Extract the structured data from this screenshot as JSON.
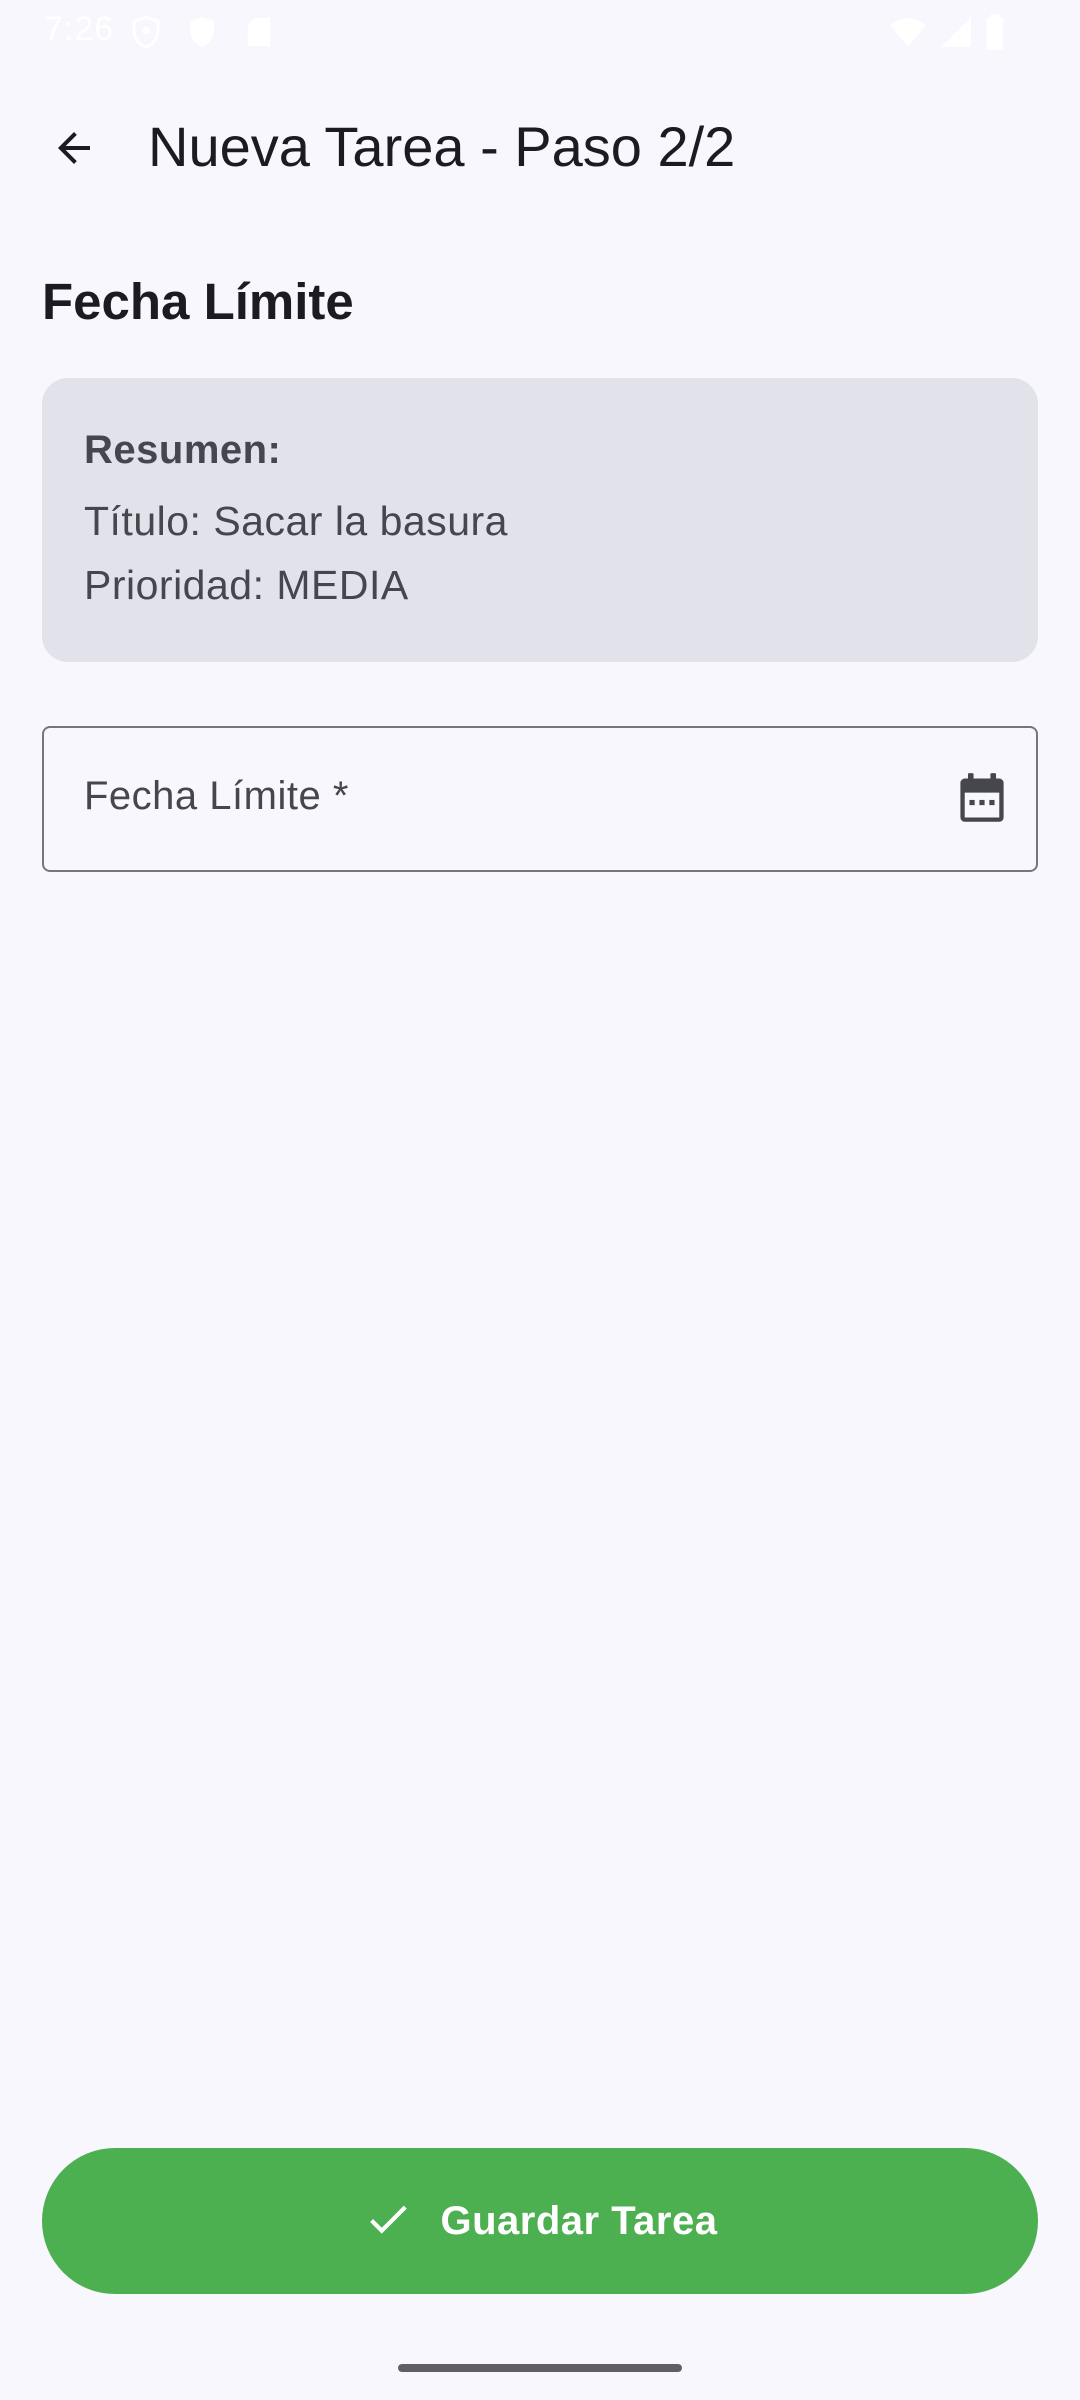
{
  "status_bar": {
    "time": "7:26",
    "icons": [
      "shield-icon",
      "location-shield-icon",
      "sd-card-icon",
      "wifi-icon",
      "cellular-signal-icon",
      "battery-icon"
    ]
  },
  "app_bar": {
    "back_icon": "arrow-back-icon",
    "title": "Nueva Tarea - Paso 2/2"
  },
  "section": {
    "title": "Fecha Límite"
  },
  "summary": {
    "heading": "Resumen:",
    "title_line": "Título: Sacar la basura",
    "priority_line": "Prioridad: MEDIA"
  },
  "date_field": {
    "label": "Fecha Límite *",
    "value": "",
    "trailing_icon": "calendar-icon"
  },
  "save_button": {
    "icon": "check-icon",
    "label": "Guardar Tarea"
  },
  "colors": {
    "background": "#f7f7fd",
    "summary_card": "#e2e2ea",
    "primary_action": "#4caf50",
    "on_primary": "#ffffff",
    "outline": "#77767f",
    "text_primary": "#1b1b21",
    "text_secondary": "#46464f"
  }
}
